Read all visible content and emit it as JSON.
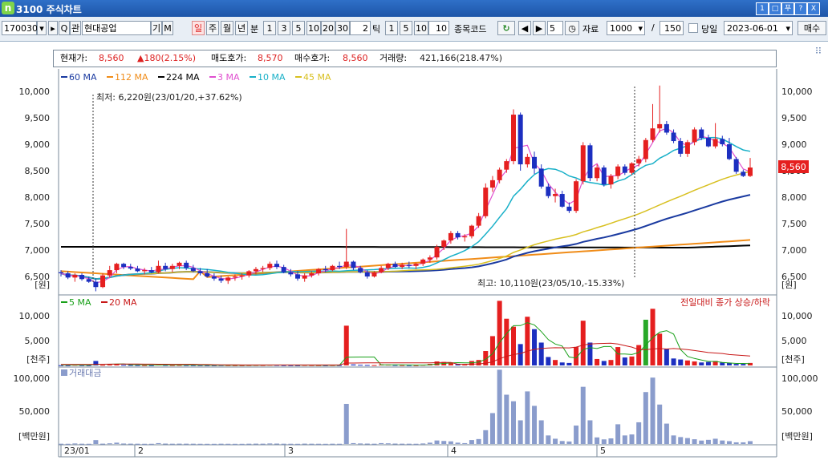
{
  "window": {
    "title": "3100 주식차트",
    "logo": "n",
    "buttons": [
      "1",
      "□",
      "푸",
      "?",
      "X"
    ]
  },
  "toolbar": {
    "code": "170030",
    "code_buttons": [
      "▾",
      "▸",
      "Q",
      "관"
    ],
    "name": "현대공업",
    "name_buttons": [
      "기",
      "M"
    ],
    "period_tabs": [
      "일",
      "주",
      "월",
      "년"
    ],
    "minute_label": "분",
    "minute_opts": [
      "1",
      "3",
      "5",
      "10",
      "20",
      "30"
    ],
    "minute_input": "2",
    "tick_label": "틱",
    "tick_opts": [
      "1",
      "5",
      "10"
    ],
    "tick_input": "10",
    "item_code_label": "종목코드",
    "nav_value": "5",
    "data_label": "자료",
    "data_count": "1000",
    "slash": "/",
    "total": "150",
    "same_day_label": "당일",
    "date": "2023-06-01",
    "trade_button": "매수"
  },
  "info": {
    "price_label": "현재가:",
    "price": "8,560",
    "change": "▲180(2.15%)",
    "ask_label": "매도호가:",
    "ask": "8,570",
    "bid_label": "매수호가:",
    "bid": "8,560",
    "volume_label": "거래량:",
    "volume": "421,166(218.47%)"
  },
  "price_legend": [
    {
      "label": "60 MA",
      "color": "#1a3aa0"
    },
    {
      "label": "112 MA",
      "color": "#f08c18"
    },
    {
      "label": "224 MA",
      "color": "#000000"
    },
    {
      "label": "3 MA",
      "color": "#e050d0"
    },
    {
      "label": "10 MA",
      "color": "#18b0c8"
    },
    {
      "label": "45 MA",
      "color": "#d8c020"
    }
  ],
  "volume_legend": [
    {
      "label": "5 MA",
      "color": "#18a018"
    },
    {
      "label": "20 MA",
      "color": "#c81818"
    }
  ],
  "annotations": {
    "low": "최저: 6,220원(23/01/20,+37.62%)",
    "high": "최고: 10,110원(23/05/10,-15.33%)",
    "volume_note": "전일대비 종가 상승/하락",
    "current_price_tag": "8,560",
    "amount_label": "거래대금"
  },
  "axes": {
    "price_ticks": [
      "10,000",
      "9,500",
      "9,000",
      "8,500",
      "8,000",
      "7,500",
      "7,000",
      "6,500"
    ],
    "price_unit": "[원]",
    "volume_ticks": [
      "10,000",
      "5,000"
    ],
    "volume_unit": "[천주]",
    "amount_ticks": [
      "100,000",
      "50,000"
    ],
    "amount_unit": "[백만원]",
    "months": [
      "23/01",
      "2",
      "3",
      "4",
      "5"
    ]
  },
  "chart_data": {
    "type": "candlestick",
    "title": "",
    "price_range": [
      6300,
      10200
    ],
    "volume_range": [
      0,
      14000
    ],
    "amount_range": [
      0,
      115000
    ],
    "candles": [
      [
        6580,
        6620,
        6500,
        6560
      ],
      [
        6560,
        6600,
        6450,
        6480
      ],
      [
        6480,
        6560,
        6400,
        6530
      ],
      [
        6530,
        6560,
        6420,
        6450
      ],
      [
        6450,
        6500,
        6380,
        6400
      ],
      [
        6400,
        6460,
        6220,
        6300
      ],
      [
        6300,
        6560,
        6280,
        6520
      ],
      [
        6520,
        6700,
        6480,
        6620
      ],
      [
        6620,
        6760,
        6560,
        6740
      ],
      [
        6740,
        6760,
        6640,
        6680
      ],
      [
        6680,
        6740,
        6620,
        6650
      ],
      [
        6650,
        6700,
        6580,
        6600
      ],
      [
        6600,
        6660,
        6540,
        6620
      ],
      [
        6620,
        6680,
        6560,
        6580
      ],
      [
        6580,
        6800,
        6560,
        6700
      ],
      [
        6700,
        6760,
        6600,
        6640
      ],
      [
        6640,
        6740,
        6580,
        6700
      ],
      [
        6700,
        6780,
        6640,
        6760
      ],
      [
        6760,
        6800,
        6620,
        6660
      ],
      [
        6660,
        6720,
        6580,
        6600
      ],
      [
        6600,
        6660,
        6520,
        6560
      ],
      [
        6560,
        6640,
        6480,
        6500
      ],
      [
        6500,
        6560,
        6420,
        6460
      ],
      [
        6460,
        6520,
        6380,
        6420
      ],
      [
        6420,
        6500,
        6360,
        6480
      ],
      [
        6480,
        6540,
        6420,
        6500
      ],
      [
        6500,
        6560,
        6440,
        6520
      ],
      [
        6520,
        6620,
        6480,
        6600
      ],
      [
        6600,
        6680,
        6540,
        6640
      ],
      [
        6640,
        6700,
        6580,
        6660
      ],
      [
        6660,
        6780,
        6620,
        6740
      ],
      [
        6740,
        6800,
        6640,
        6680
      ],
      [
        6680,
        6720,
        6560,
        6580
      ],
      [
        6580,
        6640,
        6500,
        6540
      ],
      [
        6540,
        6600,
        6420,
        6460
      ],
      [
        6460,
        6560,
        6400,
        6520
      ],
      [
        6520,
        6600,
        6480,
        6560
      ],
      [
        6560,
        6660,
        6520,
        6640
      ],
      [
        6640,
        6700,
        6580,
        6620
      ],
      [
        6620,
        6720,
        6600,
        6700
      ],
      [
        6700,
        6780,
        6640,
        6680
      ],
      [
        6680,
        7400,
        6640,
        6780
      ],
      [
        6780,
        6800,
        6620,
        6660
      ],
      [
        6660,
        6700,
        6560,
        6580
      ],
      [
        6580,
        6620,
        6460,
        6500
      ],
      [
        6500,
        6600,
        6480,
        6580
      ],
      [
        6580,
        6700,
        6560,
        6660
      ],
      [
        6660,
        6760,
        6620,
        6740
      ],
      [
        6740,
        6780,
        6660,
        6680
      ],
      [
        6680,
        6760,
        6640,
        6720
      ],
      [
        6720,
        6780,
        6660,
        6700
      ],
      [
        6700,
        6760,
        6640,
        6740
      ],
      [
        6740,
        6840,
        6700,
        6820
      ],
      [
        6820,
        6900,
        6760,
        6860
      ],
      [
        6860,
        7100,
        6820,
        7060
      ],
      [
        7060,
        7200,
        7000,
        7180
      ],
      [
        7180,
        7360,
        7120,
        7320
      ],
      [
        7320,
        7360,
        7200,
        7240
      ],
      [
        7240,
        7300,
        7160,
        7260
      ],
      [
        7260,
        7480,
        7220,
        7460
      ],
      [
        7460,
        7700,
        7420,
        7640
      ],
      [
        7640,
        8260,
        7600,
        8180
      ],
      [
        8180,
        8400,
        8100,
        8320
      ],
      [
        8320,
        8560,
        8260,
        8520
      ],
      [
        8520,
        8720,
        8460,
        8680
      ],
      [
        8680,
        9660,
        8620,
        9560
      ],
      [
        9560,
        9600,
        8500,
        8620
      ],
      [
        8620,
        8820,
        8560,
        8760
      ],
      [
        8760,
        8860,
        8440,
        8540
      ],
      [
        8540,
        8620,
        8160,
        8200
      ],
      [
        8200,
        8260,
        7980,
        8020
      ],
      [
        8020,
        8160,
        7900,
        8060
      ],
      [
        8060,
        8120,
        7800,
        7820
      ],
      [
        7820,
        7900,
        7700,
        7740
      ],
      [
        7740,
        8340,
        7700,
        8300
      ],
      [
        8300,
        9040,
        8240,
        8980
      ],
      [
        8980,
        9020,
        8300,
        8360
      ],
      [
        8360,
        8620,
        8300,
        8560
      ],
      [
        8560,
        8600,
        8200,
        8240
      ],
      [
        8240,
        8440,
        8160,
        8400
      ],
      [
        8400,
        8620,
        8340,
        8580
      ],
      [
        8580,
        8620,
        8420,
        8460
      ],
      [
        8460,
        8660,
        8420,
        8640
      ],
      [
        8640,
        8780,
        8580,
        8720
      ],
      [
        8720,
        9120,
        8660,
        9080
      ],
      [
        9080,
        9760,
        9040,
        9300
      ],
      [
        9300,
        10110,
        9220,
        9380
      ],
      [
        9380,
        9440,
        9180,
        9220
      ],
      [
        9220,
        9280,
        9020,
        9060
      ],
      [
        9060,
        9120,
        8760,
        8820
      ],
      [
        8820,
        9080,
        8760,
        9040
      ],
      [
        9040,
        9320,
        8980,
        9280
      ],
      [
        9280,
        9320,
        9080,
        9120
      ],
      [
        9120,
        9180,
        8940,
        8960
      ],
      [
        8960,
        9400,
        8920,
        9100
      ],
      [
        9100,
        9160,
        8960,
        9000
      ],
      [
        9000,
        9120,
        8700,
        8720
      ],
      [
        8720,
        8760,
        8440,
        8480
      ],
      [
        8480,
        8520,
        8380,
        8400
      ],
      [
        8400,
        8740,
        8380,
        8560
      ]
    ],
    "volume": [
      50,
      40,
      120,
      60,
      40,
      900,
      80,
      150,
      300,
      100,
      80,
      60,
      50,
      40,
      200,
      90,
      60,
      80,
      70,
      60,
      50,
      40,
      40,
      60,
      50,
      40,
      40,
      60,
      80,
      70,
      120,
      90,
      60,
      50,
      40,
      80,
      60,
      50,
      40,
      60,
      50,
      8000,
      200,
      120,
      90,
      60,
      200,
      150,
      90,
      70,
      60,
      50,
      120,
      300,
      800,
      700,
      600,
      300,
      200,
      900,
      1100,
      2900,
      5900,
      13000,
      9400,
      7800,
      4300,
      9800,
      7300,
      4600,
      1700,
      1100,
      600,
      500,
      3700,
      9000,
      4600,
      1300,
      900,
      1100,
      3700,
      1600,
      1800,
      4100,
      9200,
      11400,
      6400,
      3300,
      1400,
      1200,
      1000,
      800,
      600,
      700,
      900,
      600,
      500,
      300,
      300,
      500
    ],
    "vol_ma5": [
      100,
      90,
      85,
      80,
      70,
      220,
      230,
      240,
      290,
      310,
      150,
      150,
      130,
      90,
      90,
      90,
      100,
      110,
      100,
      80,
      70,
      60,
      55,
      50,
      50,
      50,
      45,
      50,
      55,
      60,
      70,
      75,
      80,
      75,
      70,
      60,
      60,
      55,
      55,
      50,
      52,
      1660,
      1680,
      1700,
      1690,
      1690,
      110,
      130,
      120,
      110,
      90,
      80,
      80,
      110,
      270,
      400,
      500,
      560,
      520,
      540,
      680,
      1240,
      2360,
      4620,
      6400,
      8000,
      8020,
      8620,
      8160,
      6800,
      5200,
      4300,
      3900,
      1700,
      1500,
      3200,
      3600,
      3400,
      3800,
      3800,
      2300,
      2300,
      2200,
      2600,
      4100,
      5600,
      6700,
      7000,
      6300,
      3200,
      1800,
      1400,
      1100,
      800,
      800,
      600,
      500,
      400,
      400,
      350
    ],
    "vol_ma20": [
      200,
      200,
      200,
      200,
      210,
      230,
      240,
      250,
      260,
      270,
      270,
      270,
      260,
      250,
      240,
      240,
      230,
      230,
      220,
      220,
      180,
      170,
      150,
      120,
      110,
      110,
      100,
      100,
      100,
      100,
      100,
      100,
      100,
      100,
      100,
      100,
      100,
      100,
      100,
      100,
      100,
      490,
      490,
      500,
      510,
      510,
      510,
      520,
      520,
      520,
      520,
      520,
      520,
      530,
      560,
      590,
      620,
      230,
      230,
      260,
      310,
      440,
      720,
      1360,
      1820,
      2200,
      2400,
      2880,
      3220,
      3400,
      3500,
      3560,
      3550,
      3540,
      3700,
      4100,
      4300,
      4400,
      4440,
      4460,
      4300,
      4000,
      3700,
      3200,
      3200,
      3300,
      3400,
      3300,
      3400,
      3300,
      3200,
      3000,
      2800,
      2600,
      2500,
      2400,
      2200,
      2100,
      2000,
      1900
    ],
    "amount": [
      400,
      300,
      800,
      400,
      300,
      5900,
      500,
      1000,
      2000,
      700,
      500,
      400,
      300,
      300,
      1300,
      600,
      400,
      500,
      450,
      400,
      300,
      250,
      250,
      400,
      300,
      250,
      250,
      400,
      500,
      450,
      800,
      600,
      400,
      330,
      260,
      520,
      400,
      330,
      260,
      400,
      330,
      61000,
      1300,
      800,
      600,
      400,
      1300,
      1000,
      600,
      450,
      400,
      330,
      800,
      2000,
      5300,
      4600,
      4000,
      2000,
      1300,
      6000,
      7500,
      21000,
      47000,
      113000,
      75000,
      65000,
      36000,
      80000,
      58000,
      36000,
      13000,
      8000,
      4500,
      3800,
      28000,
      87000,
      36000,
      10000,
      7000,
      8500,
      30000,
      13000,
      14500,
      33000,
      79000,
      101000,
      60000,
      31000,
      13000,
      10500,
      9000,
      7200,
      5200,
      6300,
      8000,
      5300,
      4300,
      2500,
      2500,
      4300
    ]
  }
}
